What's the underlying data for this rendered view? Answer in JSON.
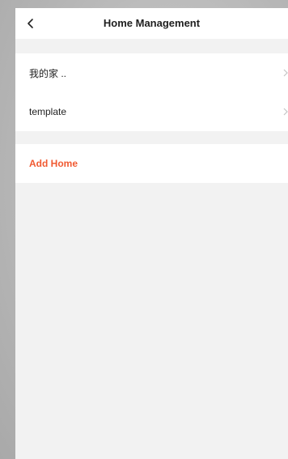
{
  "header": {
    "title": "Home Management",
    "back_icon": "chevron-left-icon"
  },
  "homes": [
    {
      "name": "我的家 ..",
      "icon": "chevron-right-icon"
    },
    {
      "name": "template",
      "icon": "chevron-right-icon"
    }
  ],
  "actions": {
    "add_home_label": "Add Home"
  },
  "colors": {
    "accent": "#f05a32",
    "page_background": "#f2f2f2",
    "card_background": "#ffffff"
  }
}
